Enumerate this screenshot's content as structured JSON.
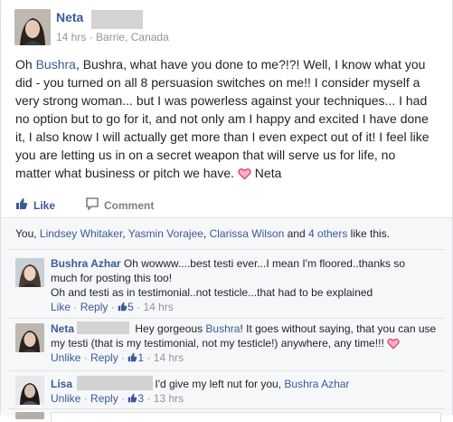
{
  "post": {
    "author": "Neta",
    "time": "14 hrs",
    "location": "Barrie, Canada",
    "lines": [
      [
        "Oh ",
        {
          "link": "Bushra"
        },
        ", Bushra, what have you done to me?!?! Well, I know what you"
      ],
      [
        "did - you turned on all 8 persuasion switches on me!! I consider myself a"
      ],
      [
        "very strong woman... but I was powerless against your techniques... I had"
      ],
      [
        "no option but to go for it, and not only am I happy and excited I have done"
      ],
      [
        "it, I also know I will actually get more than I even expect out of it! I feel like"
      ],
      [
        "you are letting us in on a secret weapon that will serve us for life, no"
      ],
      [
        "matter what business or pitch we have. ",
        {
          "heart": true
        },
        " Neta"
      ]
    ]
  },
  "actions": {
    "like": "Like",
    "comment": "Comment"
  },
  "likes": {
    "prefix": "You, ",
    "names": [
      "Lindsey Whitaker",
      "Yasmin Vorajee",
      "Clarissa Wilson"
    ],
    "and": " and ",
    "others": "4 others",
    "suffix": " like this."
  },
  "comments": [
    {
      "name": "Bushra Azhar",
      "lines": [
        "Oh wowww....best testi ever...I mean I'm floored..thanks so",
        "much for posting this too!",
        "Oh and testi as in testimonial..not testicle...that had to be explained"
      ],
      "like": "Like",
      "reply": "Reply",
      "count": "5",
      "time": "14 hrs"
    },
    {
      "name": "Neta",
      "line1_pre": "Hey gorgeous ",
      "line1_link": "Bushra",
      "line1_post": "! It goes without saying, that you can use",
      "line2": "my testi (that is my testimonial, not my testicle!) anywhere, any time!!! ",
      "like": "Unlike",
      "reply": "Reply",
      "count": "1",
      "time": "14 hrs"
    },
    {
      "name": "Lisa",
      "text": "I'd give my left nut for you, ",
      "mention": "Bushra Azhar",
      "like": "Unlike",
      "reply": "Reply",
      "count": "3",
      "time": "13 hrs"
    }
  ],
  "colors": {
    "link": "#3b5998",
    "heart": "#e0245e",
    "meta": "#90949c",
    "feedback_bg": "#f6f7f9"
  },
  "icons": {
    "like": "thumbs-up-icon",
    "comment": "speech-bubble-icon",
    "heart": "heart-icon",
    "comment_like": "small-thumbs-up-icon"
  }
}
